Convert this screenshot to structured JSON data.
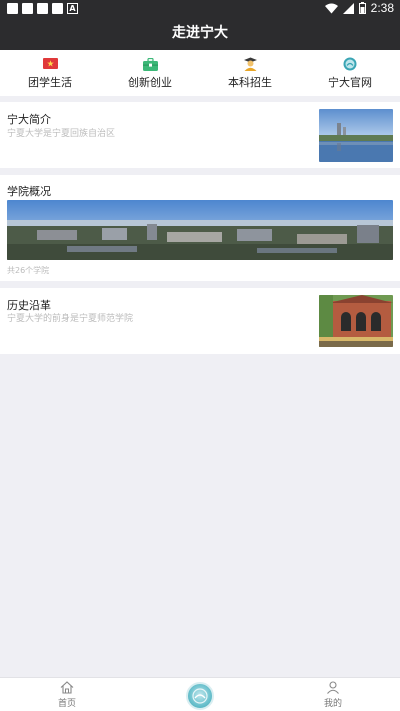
{
  "status_bar": {
    "time": "2:38",
    "notif_letter": "A"
  },
  "header": {
    "title": "走进宁大"
  },
  "quick_nav": [
    {
      "label": "团学生活",
      "icon": "flag-icon",
      "color": "#e0393a"
    },
    {
      "label": "创新创业",
      "icon": "briefcase-icon",
      "color": "#3cb878"
    },
    {
      "label": "本科招生",
      "icon": "graduate-icon",
      "color": "#e8a628"
    },
    {
      "label": "宁大官网",
      "icon": "university-logo-icon",
      "color": "#3aa5b4"
    }
  ],
  "cards": [
    {
      "title": "宁大简介",
      "subtitle": "宁夏大学是宁夏回族自治区",
      "image": "campus-lake-photo"
    },
    {
      "title": "学院概况",
      "subtitle": "共26个学院",
      "image": "campus-panorama-photo"
    },
    {
      "title": "历史沿革",
      "subtitle": "宁夏大学的前身是宁夏师范学院",
      "image": "historic-building-photo"
    }
  ],
  "tab_bar": {
    "home_label": "首页",
    "mine_label": "我的"
  }
}
